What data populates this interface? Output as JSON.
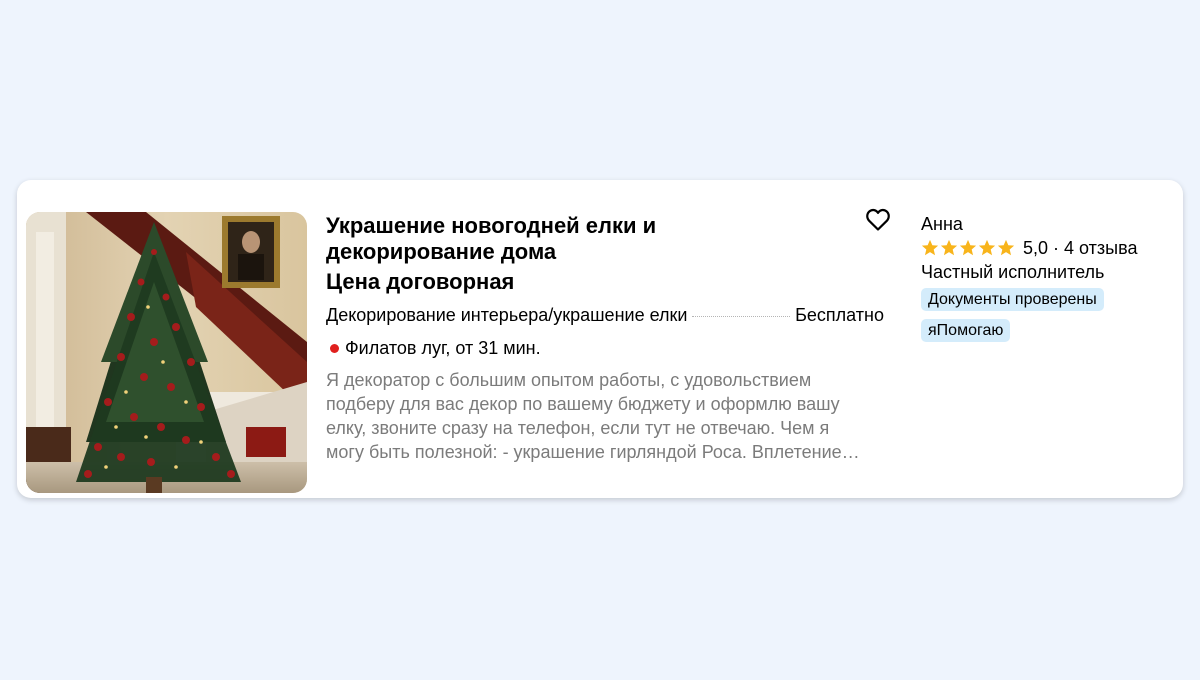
{
  "listing": {
    "title": "Украшение новогодней елки и декорирование дома",
    "price": "Цена договорная",
    "service": {
      "name": "Декорирование интерьера/украшение елки",
      "price": "Бесплатно"
    },
    "location": {
      "metro": "Филатов луг, от 31 мин.",
      "metro_color": "#e0201e"
    },
    "description": "Я декоратор с большим опытом работы, с удовольствием подберу для вас декор по вашему бюджету и оформлю вашу елку, звоните сразу на телефон, если тут не отвечаю. Чем я могу быть полезной: - украшение гирляндой Роса. Вплетение…",
    "photo_icon": "christmas-tree-photo",
    "favorite_icon": "heart-outline-icon"
  },
  "seller": {
    "name": "Анна",
    "rating": "5,0",
    "rating_value": 5,
    "reviews": "4 отзыва",
    "separator": "·",
    "type": "Частный исполнитель",
    "badges": [
      "Документы проверены",
      "яПомогаю"
    ],
    "star_color": "#f8b41b"
  },
  "colors": {
    "background": "#eef4fd",
    "card": "#ffffff",
    "badge_bg": "#d4ecfb",
    "description": "#7b7b7b"
  }
}
